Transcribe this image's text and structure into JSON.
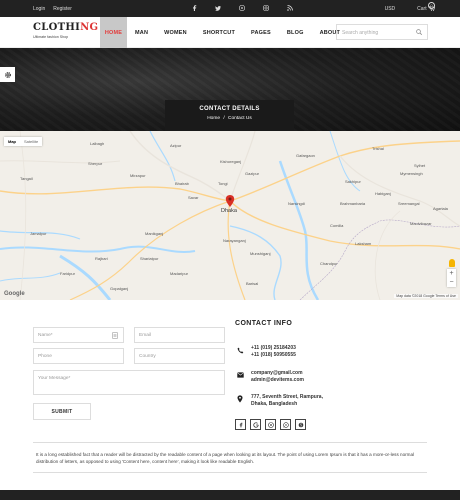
{
  "topbar": {
    "login": "Login",
    "register": "Register",
    "social": [
      "facebook-icon",
      "twitter-icon",
      "pinterest-icon",
      "instagram-icon",
      "rss-icon"
    ],
    "currency": "USD",
    "cart_label": "Cart",
    "cart_count": "0"
  },
  "brand": {
    "name_main": "CLOTHI",
    "name_accent": "NG",
    "tagline": "Ultimate fashion Shop"
  },
  "menu": [
    "HOME",
    "MAN",
    "WOMEN",
    "SHORTCUT",
    "PAGES",
    "BLOG",
    "ABOUT"
  ],
  "search": {
    "placeholder": "Search anything"
  },
  "hero": {
    "title": "CONTACT DETAILS",
    "breadcrumb_home": "Home",
    "breadcrumb_sep": "/",
    "breadcrumb_current": "Contact Us"
  },
  "map": {
    "type_map": "Map",
    "type_satellite": "Satellite",
    "google": "Google",
    "attribution": "Map data ©2018 Google    Terms of Use",
    "zoom_in": "+",
    "zoom_out": "−",
    "places": [
      "Lalbagh",
      "Azipur",
      "Trishal",
      "Gafargaon",
      "Kishoreganj",
      "Mymensingh",
      "Sherpur",
      "Tangail",
      "Sakhipur",
      "Bhairab",
      "Sreemangal",
      "Dhaka",
      "Narayanganj",
      "Comilla",
      "Agartala",
      "Chandpur",
      "Munshiganj",
      "Manikganj",
      "Faridpur",
      "Madaripur",
      "Sylhet",
      "Jamalpur",
      "Gopalganj",
      "Barisal",
      "Savar",
      "Tongi",
      "Gazipur",
      "Narsingdi",
      "Habiganj",
      "Rajbari",
      "Shariatpur",
      "Mirzapur",
      "Brahmanbaria",
      "Maulvibazar",
      "Laksham"
    ]
  },
  "form": {
    "name_placeholder": "Name*",
    "email_placeholder": "Email",
    "phone_placeholder": "Phone",
    "country_placeholder": "Country",
    "message_placeholder": "Your Message*",
    "submit_label": "SUBMIT"
  },
  "contact": {
    "heading": "CONTACT INFO",
    "phone1": "+11 (019) 25184203",
    "phone2": "+11 (018) 50950555",
    "email1": "company@gmail.com",
    "email2": "admin@devitems.com",
    "address1": "777, Seventh Street, Rampura,",
    "address2": "Dhaka, Bangladesh",
    "socials": [
      "facebook-icon",
      "google-icon",
      "pinterest-icon",
      "whatsapp-icon",
      "skype-icon"
    ]
  },
  "note": "It is a long established fact that a reader will be distracted by the readable content of a page when looking at its layout. The point of using Lorem Ipsum is that it has a more-or-less normal distribution of letters, as opposed to using 'Content here, content here', making it look like readable English."
}
